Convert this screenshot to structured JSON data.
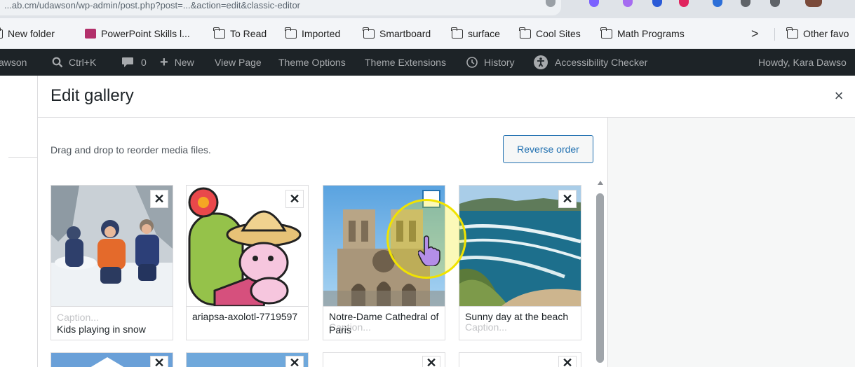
{
  "browser": {
    "url": "...ab.cm/udawson/wp-admin/post.php?post=...&action=edit&classic-editor"
  },
  "bookmarks": [
    {
      "label": "New folder",
      "type": "folder"
    },
    {
      "label": "PowerPoint Skills l...",
      "type": "ppt"
    },
    {
      "label": "To Read",
      "type": "folder"
    },
    {
      "label": "Imported",
      "type": "folder"
    },
    {
      "label": "Smartboard",
      "type": "folder"
    },
    {
      "label": "surface",
      "type": "folder"
    },
    {
      "label": "Cool Sites",
      "type": "folder"
    },
    {
      "label": "Math Programs",
      "type": "folder"
    },
    {
      "label": ">",
      "type": "chevron"
    },
    {
      "label": "Other favo",
      "type": "folder"
    }
  ],
  "adminbar": {
    "site": "awson",
    "search": "Ctrl+K",
    "comments": "0",
    "new": "New",
    "view_page": "View Page",
    "theme_options": "Theme Options",
    "theme_extensions": "Theme Extensions",
    "history": "History",
    "accessibility": "Accessibility Checker",
    "howdy": "Howdy, Kara Dawso"
  },
  "modal": {
    "title": "Edit gallery",
    "close": "×",
    "instructions": "Drag and drop to reorder media files.",
    "reverse_order": "Reverse order",
    "caption_placeholder": "Caption...",
    "remove": "✕",
    "items": [
      {
        "caption": "Kids playing in snow"
      },
      {
        "caption": "ariapsa-axolotl-7719597"
      },
      {
        "caption": "Notre-Dame Cathedral of Paris"
      },
      {
        "caption": "Sunny day at the beach"
      }
    ]
  }
}
